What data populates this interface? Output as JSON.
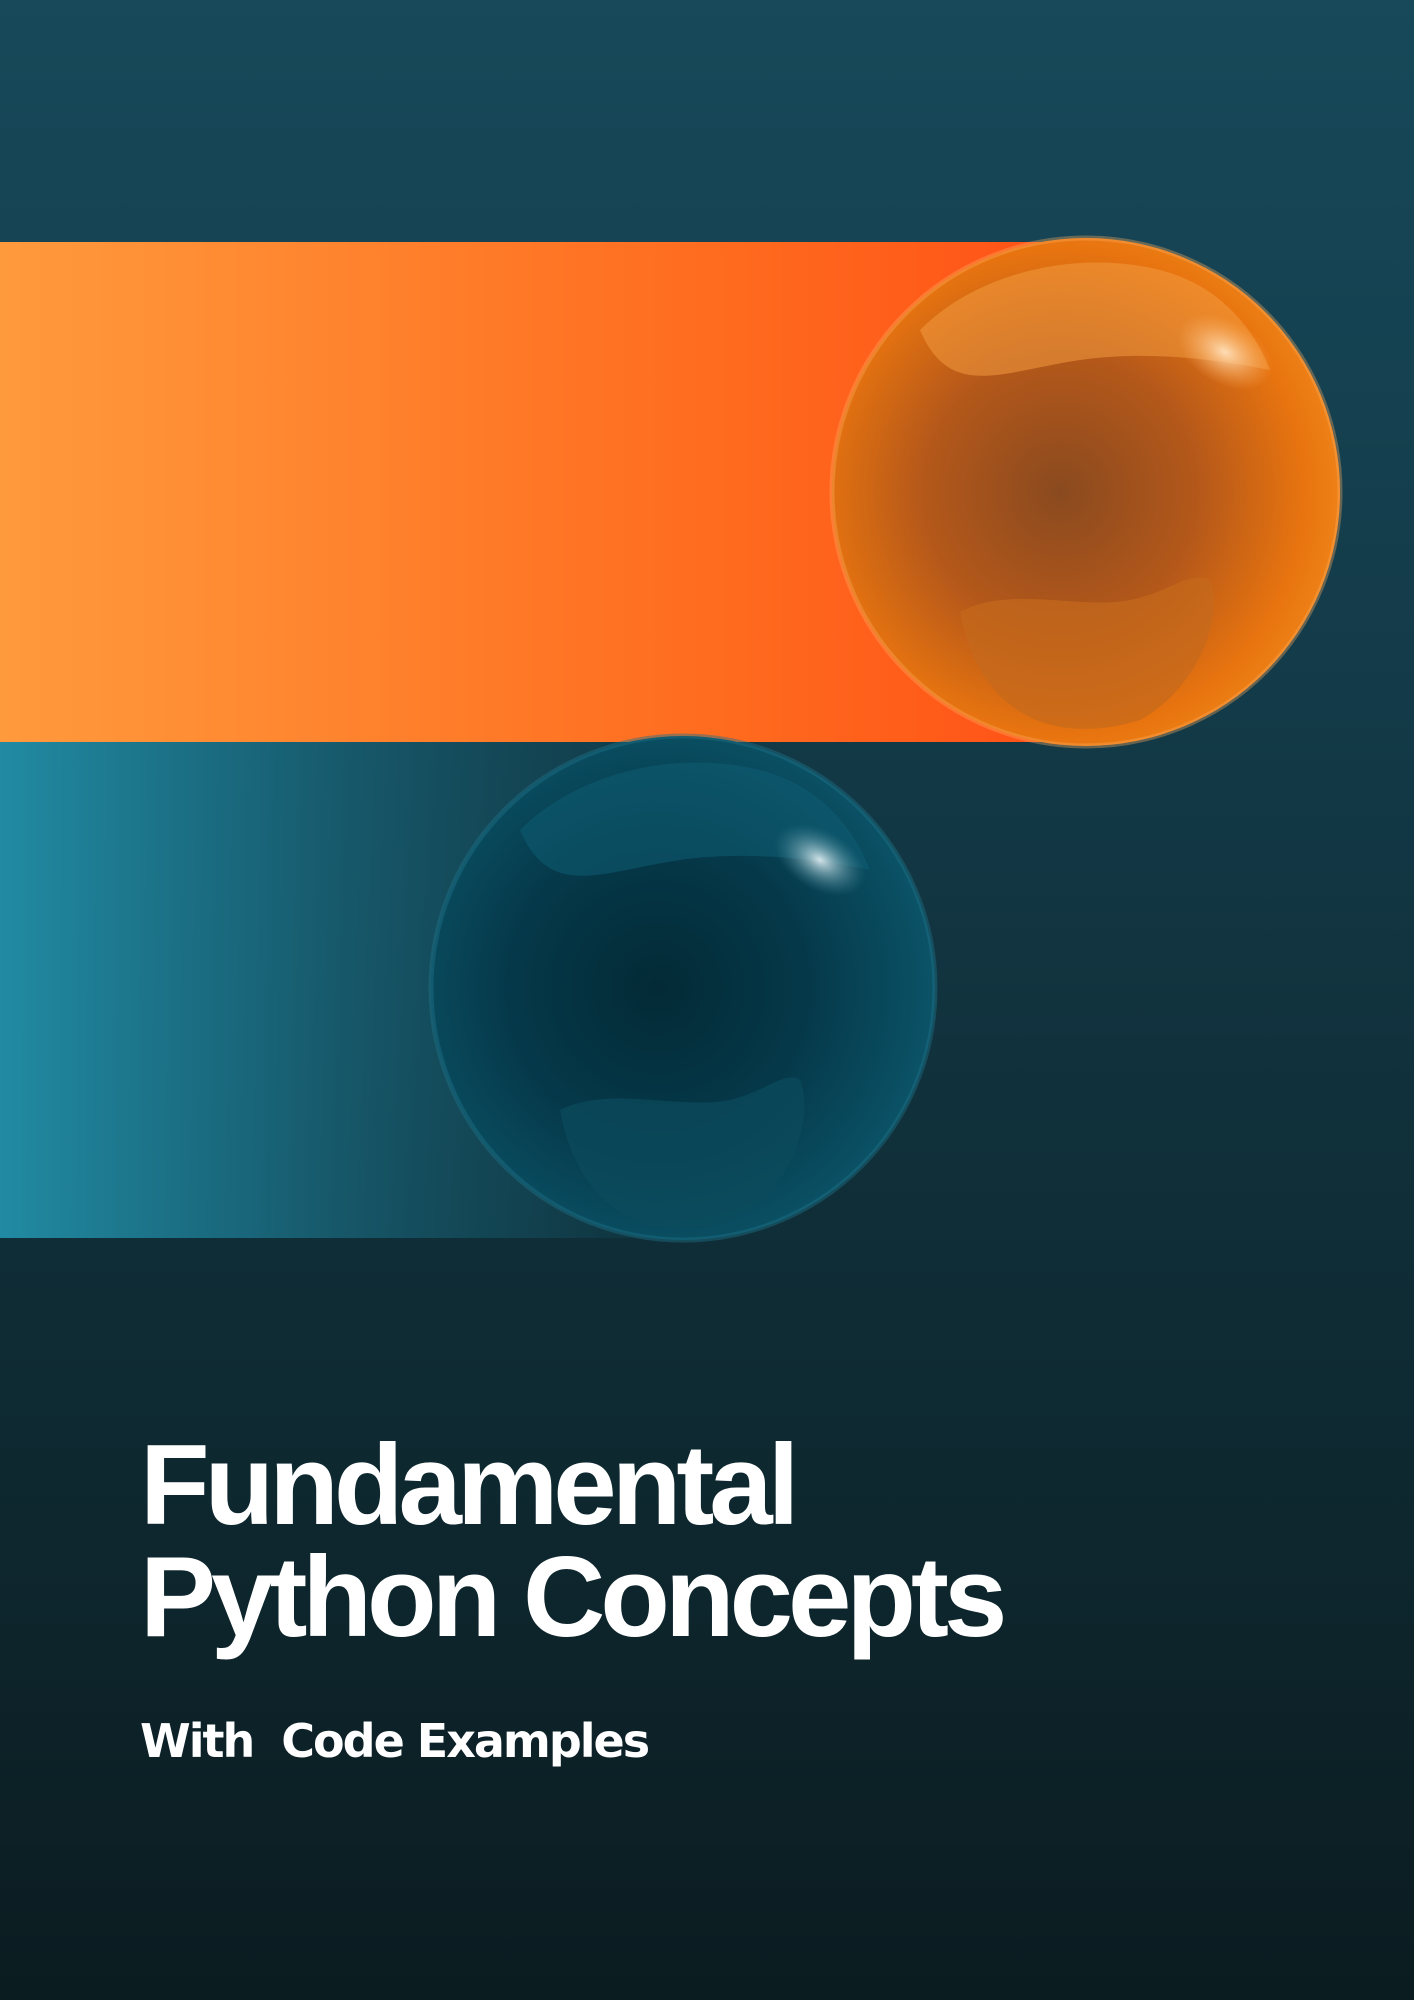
{
  "cover": {
    "title_line_1": "Fundamental",
    "title_line_2": "Python Concepts",
    "subtitle": "With  Code Examples"
  },
  "colors": {
    "background_top": "#17495a",
    "background_bottom": "#0b1c20",
    "orange_band_start": "#ff9a3c",
    "orange_band_end": "#ff3d10",
    "teal_band_start": "#218ba3",
    "teal_ball": "#0a4a5c",
    "orange_ball": "#e8740f",
    "title_text": "#ffffff"
  },
  "images": {
    "orange_band": "orange-speed-band",
    "orange_ball": "orange-glossy-sphere",
    "teal_band": "teal-speed-band",
    "teal_ball": "teal-glossy-sphere"
  }
}
